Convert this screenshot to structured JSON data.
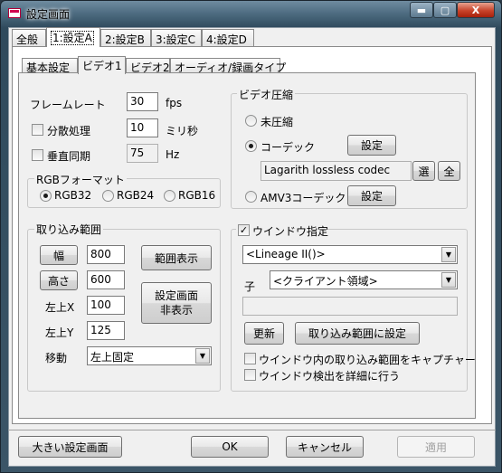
{
  "window": {
    "title": "設定画面",
    "minimize_glyph": "▬",
    "maximize_glyph": "▢",
    "close_glyph": "X"
  },
  "top_tabs": [
    "全般",
    "1:設定A",
    "2:設定B",
    "3:設定C",
    "4:設定D"
  ],
  "inner_tabs": [
    "基本設定",
    "ビデオ1",
    "ビデオ2",
    "オーディオ/録画タイプ"
  ],
  "frame_rate": {
    "label": "フレームレート",
    "value": "30",
    "unit": "fps"
  },
  "distributed": {
    "label": "分散処理",
    "value": "10",
    "unit": "ミリ秒",
    "checked": false
  },
  "vsync": {
    "label": "垂直同期",
    "value": "75",
    "unit": "Hz",
    "checked": false
  },
  "rgb_format": {
    "legend": "RGBフォーマット",
    "options": [
      "RGB32",
      "RGB24",
      "RGB16"
    ],
    "selected": "RGB32"
  },
  "capture_range": {
    "legend": "取り込み範囲",
    "width_button": "幅",
    "width_value": "800",
    "height_button": "高さ",
    "height_value": "600",
    "left_label": "左上X",
    "left_value": "100",
    "top_label": "左上Y",
    "top_value": "125",
    "show_range_button": "範囲表示",
    "hide_settings_button_line1": "設定画面",
    "hide_settings_button_line2": "非表示",
    "move_label": "移動",
    "move_value": "左上固定"
  },
  "video_compression": {
    "legend": "ビデオ圧縮",
    "uncompressed_label": "未圧縮",
    "codec_label": "コーデック",
    "codec_settings_button": "設定",
    "codec_name": "Lagarith lossless codec",
    "select_button": "選",
    "all_button": "全",
    "amv3_label": "AMV3コーデック",
    "amv3_settings_button": "設定",
    "selected": "コーデック"
  },
  "window_spec": {
    "legend": "ウインドウ指定",
    "checked": true,
    "window_value": "<Lineage II()>",
    "child_label": "子",
    "child_value": "<クライアント領域>",
    "text_value": "",
    "update_button": "更新",
    "set_range_button": "取り込み範囲に設定",
    "capture_inside_label": "ウインドウ内の取り込み範囲をキャプチャー",
    "capture_inside_checked": false,
    "detailed_detect_label": "ウインドウ検出を詳細に行う",
    "detailed_detect_checked": false
  },
  "footer": {
    "big_settings_button": "大きい設定画面",
    "ok_button": "OK",
    "cancel_button": "キャンセル",
    "apply_button": "適用"
  }
}
